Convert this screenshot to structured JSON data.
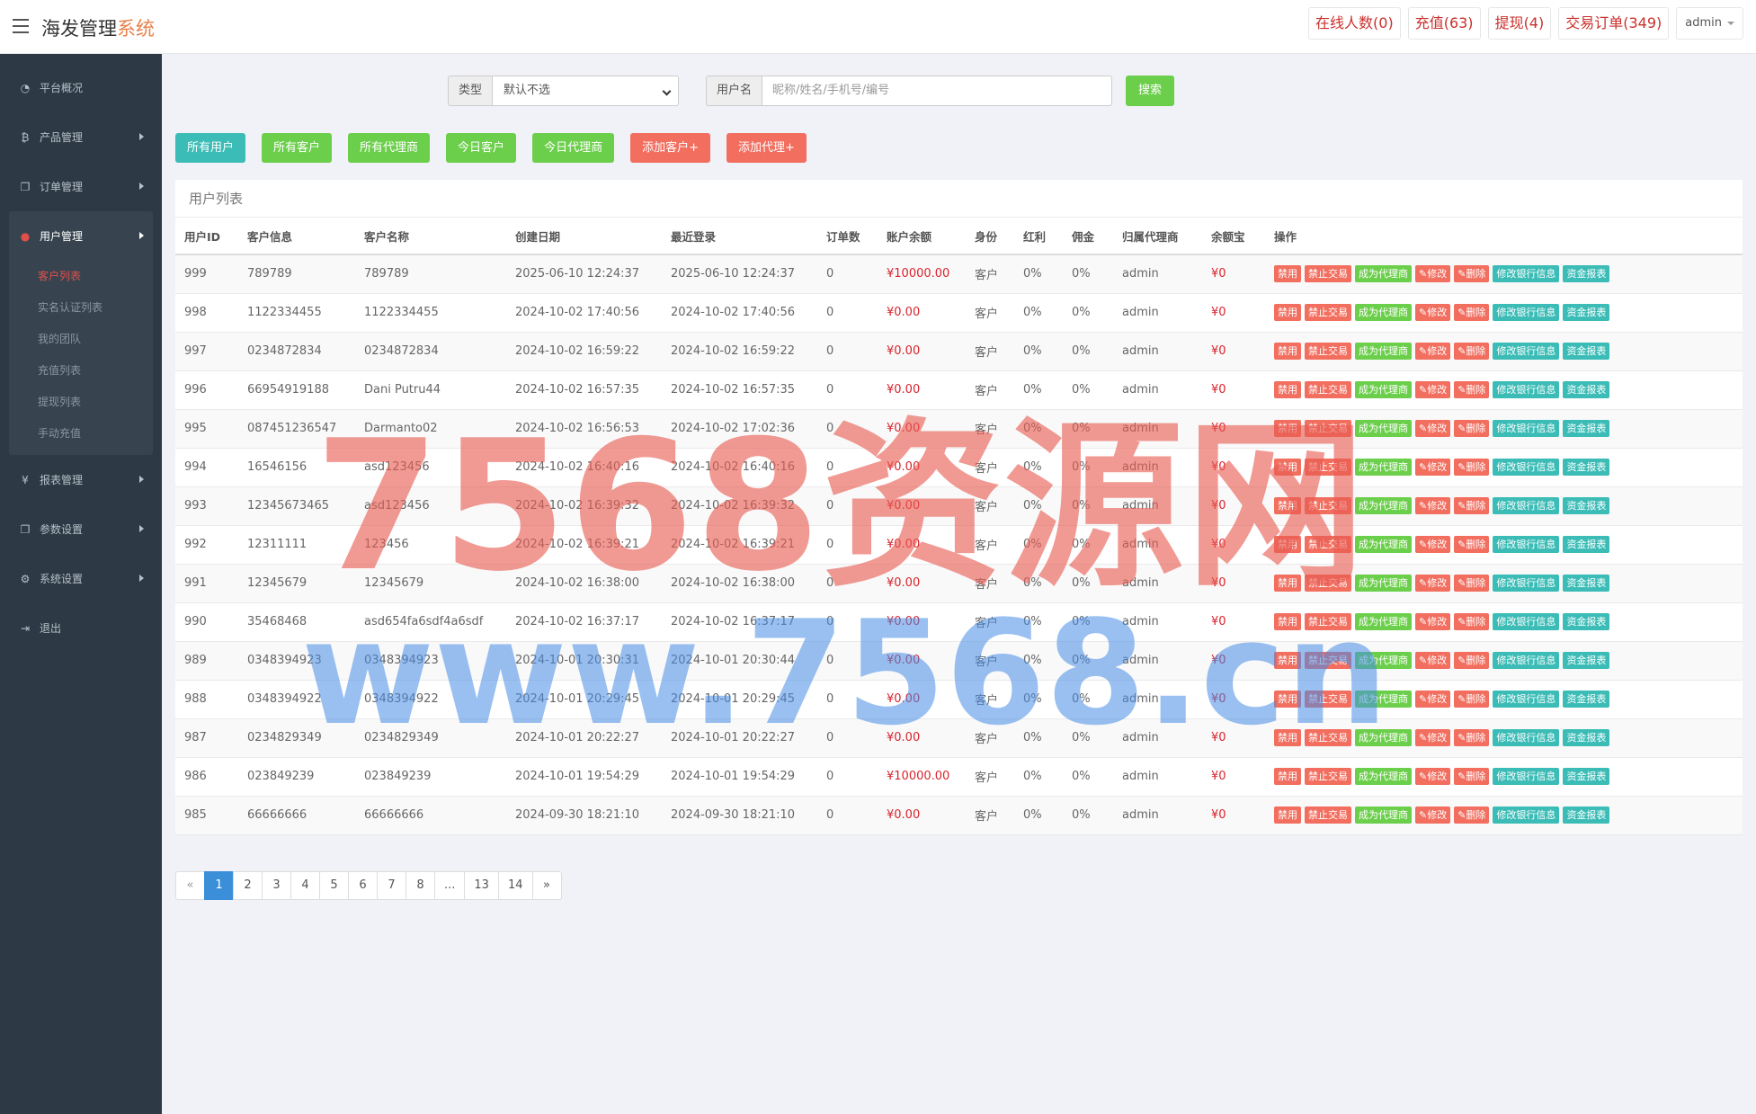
{
  "brand": {
    "main": "海发管理",
    "accent": "系统"
  },
  "topbar": {
    "online": "在线人数(0)",
    "recharge": "充值(63)",
    "withdraw": "提现(4)",
    "orders": "交易订单(349)",
    "user": "admin"
  },
  "sidebar": {
    "overview": "平台概况",
    "product": "产品管理",
    "order": "订单管理",
    "user": "用户管理",
    "sub": [
      "客户列表",
      "实名认证列表",
      "我的团队",
      "充值列表",
      "提现列表",
      "手动充值"
    ],
    "report": "报表管理",
    "params": "参数设置",
    "system": "系统设置",
    "logout": "退出"
  },
  "search": {
    "type_label": "类型",
    "type_value": "默认不选",
    "user_label": "用户名",
    "user_placeholder": "昵称/姓名/手机号/编号",
    "button": "搜索"
  },
  "filters": [
    "所有用户",
    "所有客户",
    "所有代理商",
    "今日客户",
    "今日代理商",
    "添加客户+",
    "添加代理+"
  ],
  "panel_title": "用户列表",
  "columns": [
    "用户ID",
    "客户信息",
    "客户名称",
    "创建日期",
    "最近登录",
    "订单数",
    "账户余额",
    "身份",
    "红利",
    "佣金",
    "归属代理商",
    "余额宝",
    "操作"
  ],
  "ops": [
    "禁用",
    "禁止交易",
    "成为代理商",
    "✎修改",
    "✎删除",
    "修改银行信息",
    "资金报表"
  ],
  "rows": [
    [
      "999",
      "789789",
      "789789",
      "2025-06-10 12:24:37",
      "2025-06-10 12:24:37",
      "0",
      "¥10000.00",
      "客户",
      "0%",
      "0%",
      "admin",
      "¥0"
    ],
    [
      "998",
      "1122334455",
      "1122334455",
      "2024-10-02 17:40:56",
      "2024-10-02 17:40:56",
      "0",
      "¥0.00",
      "客户",
      "0%",
      "0%",
      "admin",
      "¥0"
    ],
    [
      "997",
      "0234872834",
      "0234872834",
      "2024-10-02 16:59:22",
      "2024-10-02 16:59:22",
      "0",
      "¥0.00",
      "客户",
      "0%",
      "0%",
      "admin",
      "¥0"
    ],
    [
      "996",
      "66954919188",
      "Dani Putru44",
      "2024-10-02 16:57:35",
      "2024-10-02 16:57:35",
      "0",
      "¥0.00",
      "客户",
      "0%",
      "0%",
      "admin",
      "¥0"
    ],
    [
      "995",
      "087451236547",
      "Darmanto02",
      "2024-10-02 16:56:53",
      "2024-10-02 17:02:36",
      "0",
      "¥0.00",
      "客户",
      "0%",
      "0%",
      "admin",
      "¥0"
    ],
    [
      "994",
      "16546156",
      "asd123456",
      "2024-10-02 16:40:16",
      "2024-10-02 16:40:16",
      "0",
      "¥0.00",
      "客户",
      "0%",
      "0%",
      "admin",
      "¥0"
    ],
    [
      "993",
      "12345673465",
      "asd123456",
      "2024-10-02 16:39:32",
      "2024-10-02 16:39:32",
      "0",
      "¥0.00",
      "客户",
      "0%",
      "0%",
      "admin",
      "¥0"
    ],
    [
      "992",
      "12311111",
      "123456",
      "2024-10-02 16:39:21",
      "2024-10-02 16:39:21",
      "0",
      "¥0.00",
      "客户",
      "0%",
      "0%",
      "admin",
      "¥0"
    ],
    [
      "991",
      "12345679",
      "12345679",
      "2024-10-02 16:38:00",
      "2024-10-02 16:38:00",
      "0",
      "¥0.00",
      "客户",
      "0%",
      "0%",
      "admin",
      "¥0"
    ],
    [
      "990",
      "35468468",
      "asd654fa6sdf4a6sdf",
      "2024-10-02 16:37:17",
      "2024-10-02 16:37:17",
      "0",
      "¥0.00",
      "客户",
      "0%",
      "0%",
      "admin",
      "¥0"
    ],
    [
      "989",
      "0348394923",
      "0348394923",
      "2024-10-01 20:30:31",
      "2024-10-01 20:30:44",
      "0",
      "¥0.00",
      "客户",
      "0%",
      "0%",
      "admin",
      "¥0"
    ],
    [
      "988",
      "0348394922",
      "0348394922",
      "2024-10-01 20:29:45",
      "2024-10-01 20:29:45",
      "0",
      "¥0.00",
      "客户",
      "0%",
      "0%",
      "admin",
      "¥0"
    ],
    [
      "987",
      "0234829349",
      "0234829349",
      "2024-10-01 20:22:27",
      "2024-10-01 20:22:27",
      "0",
      "¥0.00",
      "客户",
      "0%",
      "0%",
      "admin",
      "¥0"
    ],
    [
      "986",
      "023849239",
      "023849239",
      "2024-10-01 19:54:29",
      "2024-10-01 19:54:29",
      "0",
      "¥10000.00",
      "客户",
      "0%",
      "0%",
      "admin",
      "¥0"
    ],
    [
      "985",
      "66666666",
      "66666666",
      "2024-09-30 18:21:10",
      "2024-09-30 18:21:10",
      "0",
      "¥0.00",
      "客户",
      "0%",
      "0%",
      "admin",
      "¥0"
    ]
  ],
  "pagination": [
    "«",
    "1",
    "2",
    "3",
    "4",
    "5",
    "6",
    "7",
    "8",
    "...",
    "13",
    "14",
    "»"
  ],
  "watermark": {
    "line1": "7568资源网",
    "line2": "www.7568.cn"
  },
  "colors": {
    "sidebar": "#2d3a45",
    "teal": "#3cbcb6",
    "green": "#6ccf4c",
    "red": "#f26e5f",
    "money": "#d9232d",
    "page_active": "#3a8fd8"
  }
}
